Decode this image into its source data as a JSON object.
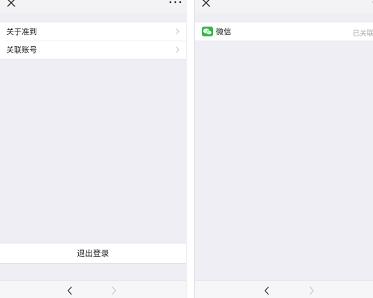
{
  "left_screen": {
    "close_icon": "close-icon",
    "more_icon": "more-icon",
    "menu": [
      {
        "label": "关于准到"
      },
      {
        "label": "关联账号"
      }
    ],
    "logout_label": "退出登录",
    "toolbar": {
      "back_icon": "chevron-left-icon",
      "forward_icon": "chevron-right-icon"
    }
  },
  "right_screen": {
    "close_icon": "close-icon",
    "more_icon": "more-icon",
    "linked_accounts": [
      {
        "icon": "wechat-icon",
        "label": "微信",
        "status": "已关联"
      }
    ],
    "toolbar": {
      "back_icon": "chevron-left-icon",
      "forward_icon": "chevron-right-icon"
    }
  },
  "colors": {
    "background": "#efeef4",
    "wechat_green": "#39b54a",
    "status_gray": "#a8a8ae"
  }
}
